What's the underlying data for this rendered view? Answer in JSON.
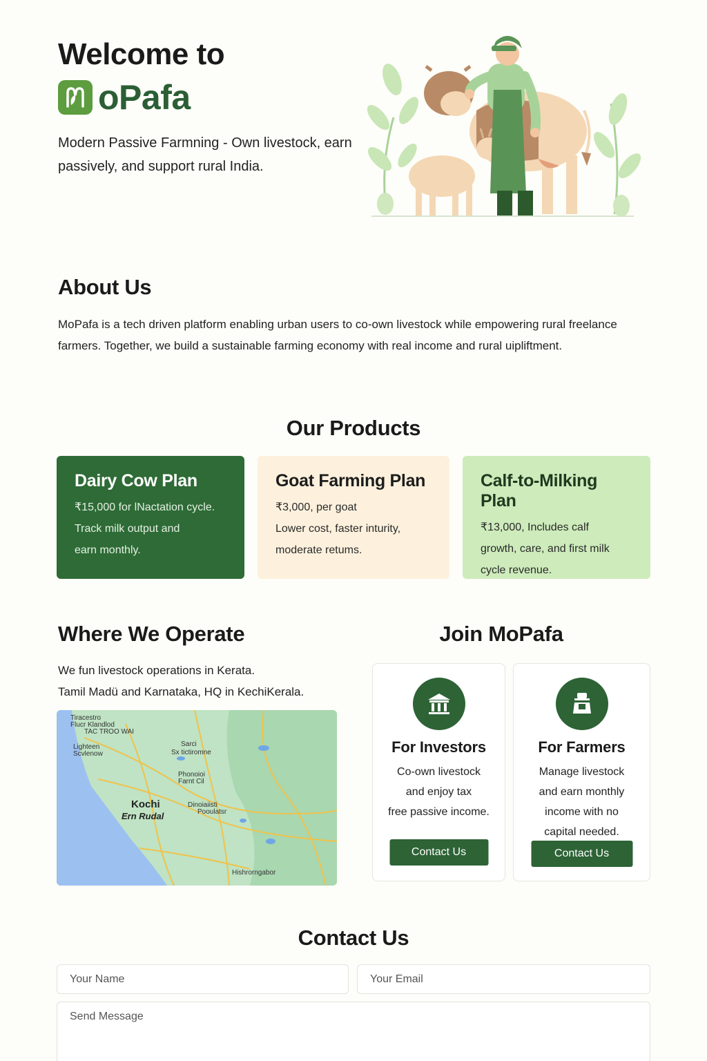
{
  "hero": {
    "title": "Welcome to",
    "brand_name": "oPafa",
    "subtitle": "Modern Passive Farmning - Own livestock, earn passively, and support rural India."
  },
  "about": {
    "heading": "About Us",
    "text": "MoPafa is a tech driven platform enabling urban users to co-own livestock while empowering rural freelance farmers. Together, we build a sustainable farming economy with real income and rural uipliftment."
  },
  "products": {
    "heading": "Our Products",
    "items": [
      {
        "title": "Dairy Cow Plan",
        "line1": "₹15,000 for lNactation cycle.",
        "line2": "Track milk output and",
        "line3": "earn monthly."
      },
      {
        "title": "Goat Farming Plan",
        "line1": "₹3,000, per goat",
        "line2": "Lower cost, faster inturity,",
        "line3": "moderate retums."
      },
      {
        "title": "Calf-to-Milking Plan",
        "line1": "₹13,000, Includes calf",
        "line2": "growth, care, and first milk",
        "line3": "cycle revenue."
      }
    ],
    "colors": {
      "dairy": "#2e6b36",
      "goat": "#fdf1dd",
      "calf": "#cdebbb"
    }
  },
  "operate": {
    "heading": "Where We Operate",
    "line1": "We fun livestock operations in Kerata.",
    "line2": "Tamil Madü  and Karnataka, HQ in KechiKerala.",
    "map": {
      "city": "Kochi",
      "city_sub": "Ern Rudal",
      "labels": [
        "Tiracestro",
        "Flucr Klandlod",
        "TAC TROO WAI",
        "Lighteen",
        "Scvlenow",
        "Sarci",
        "Sx tictiromne",
        "Phonoioi",
        "Farnt Cil",
        "Dinoiaiisti",
        "Pooulatsr",
        "Hishrorngabor"
      ]
    }
  },
  "join": {
    "heading": "Join MoPafa",
    "investors": {
      "title": "For Investors",
      "l1": "Co-own livestock",
      "l2": "and enjoy tax",
      "l3": "free passive income.",
      "button": "Contact Us",
      "icon": "bank-icon"
    },
    "farmers": {
      "title": "For Farmers",
      "l1": "Manage livestock",
      "l2": "and earn monthly",
      "l3": "income with no",
      "l4": "capital needed.",
      "button": "Contact Us",
      "icon": "farmer-icon"
    }
  },
  "contact": {
    "heading": "Contact Us",
    "name_placeholder": "Your Name",
    "email_placeholder": "Your Email",
    "message_placeholder": "Send Message"
  },
  "theme": {
    "primary": "#2d6335",
    "brand_green": "#2b5e34",
    "background": "#fdfdf9"
  }
}
